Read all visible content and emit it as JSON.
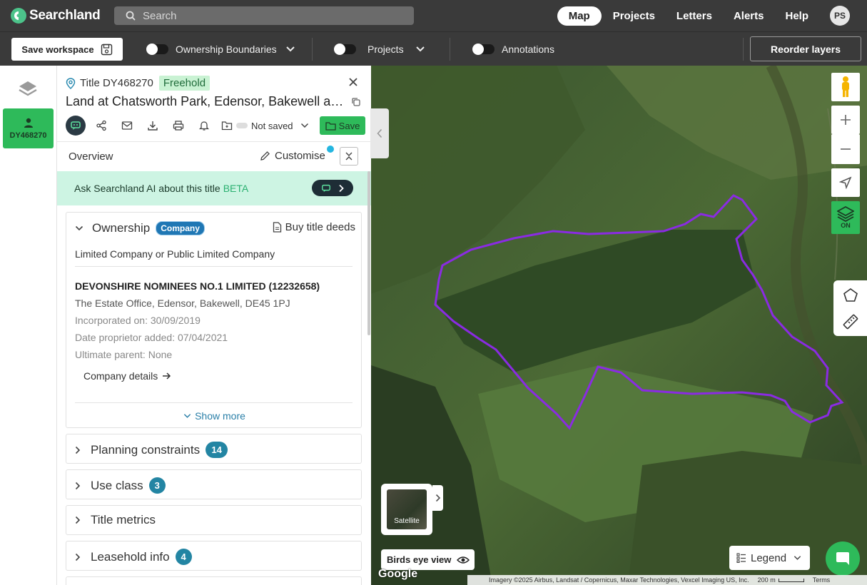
{
  "app": {
    "name": "Searchland"
  },
  "search": {
    "placeholder": "Search"
  },
  "nav": {
    "map": "Map",
    "projects": "Projects",
    "letters": "Letters",
    "alerts": "Alerts",
    "help": "Help",
    "avatar": "PS"
  },
  "toolbar": {
    "save_workspace": "Save workspace",
    "toggles": [
      {
        "label": "Ownership Boundaries",
        "on": false
      },
      {
        "label": "Projects",
        "on": false
      },
      {
        "label": "Annotations",
        "on": false
      }
    ],
    "reorder_layers": "Reorder layers"
  },
  "leftrail": {
    "tab_label": "DY468270"
  },
  "panel": {
    "title_prefix": "Title DY468270",
    "tenure": "Freehold",
    "name": "Land at Chatsworth Park, Edensor, Bakewell and...",
    "save_status": "Not saved",
    "save_label": "Save",
    "overview": "Overview",
    "customise": "Customise",
    "ai_prompt": "Ask Searchland AI about this title",
    "ai_beta": "BETA",
    "ownership": {
      "heading": "Ownership",
      "badge": "Company",
      "buy": "Buy title deeds",
      "company_type": "Limited Company or Public Limited Company",
      "company_name": "DEVONSHIRE NOMINEES NO.1 LIMITED (12232658)",
      "address": "The Estate Office, Edensor, Bakewell, DE45 1PJ",
      "incorporated": "Incorporated on: 30/09/2019",
      "proprietor_added": "Date proprietor added: 07/04/2021",
      "ultimate_parent": "Ultimate parent:  None",
      "details_link": "Company details",
      "show_more": "Show more"
    },
    "sections": [
      {
        "label": "Planning constraints",
        "count": "14"
      },
      {
        "label": "Use class",
        "count": "3"
      },
      {
        "label": "Title metrics",
        "count": ""
      },
      {
        "label": "Leasehold info",
        "count": "4"
      }
    ]
  },
  "map": {
    "layers_on": "ON",
    "satellite": "Satellite",
    "birds_eye": "Birds eye view",
    "legend": "Legend",
    "attribution": "Imagery ©2025 Airbus, Landsat / Copernicus, Maxar Technologies, Vexcel Imaging US, Inc.",
    "scale": "200 m",
    "terms": "Terms",
    "google": "Google",
    "boundary_color": "#8a2be2"
  },
  "colors": {
    "accent_green": "#2eba5a",
    "topbar": "#3a3a3a",
    "badge_blue": "#2385a3"
  }
}
